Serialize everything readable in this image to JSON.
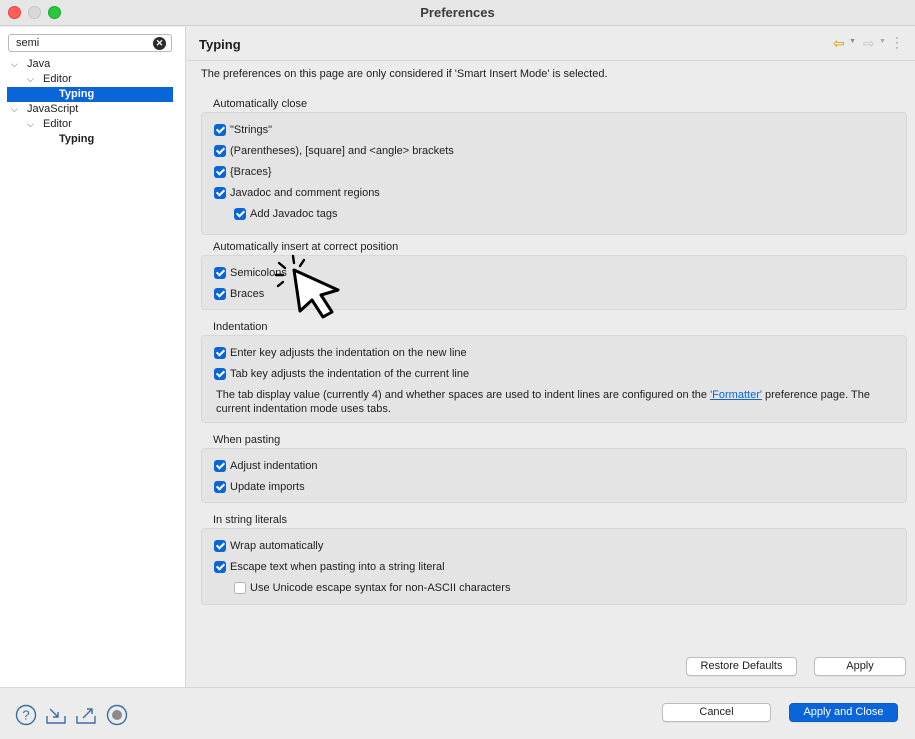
{
  "window": {
    "title": "Preferences"
  },
  "sidebar": {
    "filter_value": "semi",
    "tree": [
      {
        "label": "Java",
        "chevron": "v",
        "level": 0
      },
      {
        "label": "Editor",
        "chevron": "v",
        "level": 1
      },
      {
        "label": "Typing",
        "level": 2,
        "selected": true
      },
      {
        "label": "JavaScript",
        "chevron": "v",
        "level": 0
      },
      {
        "label": "Editor",
        "chevron": "v",
        "level": 1
      },
      {
        "label": "Typing",
        "level": 2,
        "selected": false
      }
    ]
  },
  "page": {
    "title": "Typing",
    "note": "The preferences on this page are only considered if 'Smart Insert Mode' is selected."
  },
  "groups": {
    "auto_close": {
      "label": "Automatically close",
      "items": [
        {
          "label": "\"Strings\"",
          "checked": true
        },
        {
          "label": "(Parentheses), [square] and <angle> brackets",
          "checked": true
        },
        {
          "label": "{Braces}",
          "checked": true
        },
        {
          "label": "Javadoc and comment regions",
          "checked": true
        },
        {
          "label": "Add Javadoc tags",
          "checked": true
        }
      ]
    },
    "auto_insert": {
      "label": "Automatically insert at correct position",
      "items": [
        {
          "label": "Semicolons",
          "checked": true
        },
        {
          "label": "Braces",
          "checked": true
        }
      ]
    },
    "indentation": {
      "label": "Indentation",
      "items": [
        {
          "label": "Enter key adjusts the indentation on the new line",
          "checked": true
        },
        {
          "label": "Tab key adjusts the indentation of the current line",
          "checked": true
        }
      ],
      "info_pre": "The tab display value (currently 4) and whether spaces are used to indent lines are configured on the ",
      "info_link": "'Formatter'",
      "info_post": " preference page. The current indentation mode uses tabs."
    },
    "pasting": {
      "label": "When pasting",
      "items": [
        {
          "label": "Adjust indentation",
          "checked": true
        },
        {
          "label": "Update imports",
          "checked": true
        }
      ]
    },
    "string_literals": {
      "label": "In string literals",
      "items": [
        {
          "label": "Wrap automatically",
          "checked": true
        },
        {
          "label": "Escape text when pasting into a string literal",
          "checked": true
        },
        {
          "label": "Use Unicode escape syntax for non-ASCII characters",
          "checked": false
        }
      ]
    }
  },
  "buttons": {
    "restore_defaults": "Restore Defaults",
    "apply": "Apply",
    "cancel": "Cancel",
    "apply_and_close": "Apply and Close"
  },
  "colors": {
    "accent": "#0a65d8",
    "back_arrow": "#d99a00"
  },
  "bottom_icons": [
    "help-icon",
    "import-icon",
    "export-icon",
    "record-icon"
  ]
}
